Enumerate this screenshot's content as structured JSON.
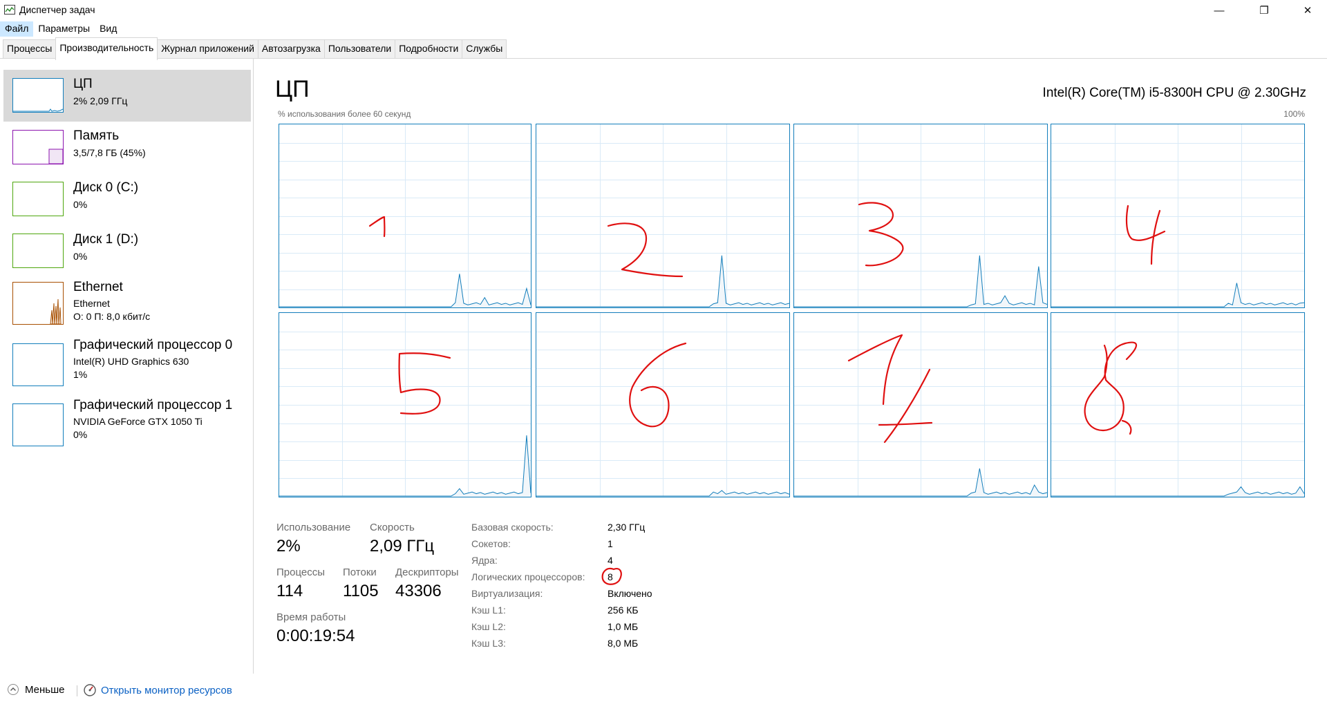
{
  "window": {
    "title": "Диспетчер задач",
    "minimize_glyph": "—",
    "maximize_glyph": "❐",
    "close_glyph": "✕"
  },
  "menu": [
    "Файл",
    "Параметры",
    "Вид"
  ],
  "tabs": [
    "Процессы",
    "Производительность",
    "Журнал приложений",
    "Автозагрузка",
    "Пользователи",
    "Подробности",
    "Службы"
  ],
  "active_tab": "Производительность",
  "sidebar": [
    {
      "name": "ЦП",
      "sub1": "2%  2,09 ГГц",
      "color": "#117dbb",
      "selected": true
    },
    {
      "name": "Память",
      "sub1": "3,5/7,8 ГБ (45%)",
      "color": "#8b12ae"
    },
    {
      "name": "Диск 0 (C:)",
      "sub1": "0%",
      "color": "#4da60c"
    },
    {
      "name": "Диск 1 (D:)",
      "sub1": "0%",
      "color": "#4da60c"
    },
    {
      "name": "Ethernet",
      "sub1": "Ethernet",
      "sub2": "О: 0  П: 8,0 кбит/с",
      "color": "#a74f01"
    },
    {
      "name": "Графический процессор 0",
      "sub1": "Intel(R) UHD Graphics 630",
      "sub2": "1%",
      "color": "#117dbb"
    },
    {
      "name": "Графический процессор 1",
      "sub1": "NVIDIA GeForce GTX 1050 Ti",
      "sub2": "0%",
      "color": "#117dbb"
    }
  ],
  "main": {
    "title": "ЦП",
    "cpu_model": "Intel(R) Core(TM) i5-8300H CPU @ 2.30GHz",
    "graph_caption": "% использования более 60 секунд",
    "graph_max": "100%",
    "graph_color": "#117dbb",
    "annotation_color": "#e01010",
    "annotations": [
      "1",
      "2",
      "3",
      "4",
      "5",
      "6",
      "7",
      "8"
    ]
  },
  "stats": {
    "usage_label": "Использование",
    "usage_value": "2%",
    "speed_label": "Скорость",
    "speed_value": "2,09 ГГц",
    "processes_label": "Процессы",
    "processes_value": "114",
    "threads_label": "Потоки",
    "threads_value": "1105",
    "handles_label": "Дескрипторы",
    "handles_value": "43306",
    "uptime_label": "Время работы",
    "uptime_value": "0:00:19:54"
  },
  "specs": [
    {
      "label": "Базовая скорость:",
      "value": "2,30 ГГц"
    },
    {
      "label": "Сокетов:",
      "value": "1"
    },
    {
      "label": "Ядра:",
      "value": "4"
    },
    {
      "label": "Логических процессоров:",
      "value": "8"
    },
    {
      "label": "Виртуализация:",
      "value": "Включено"
    },
    {
      "label": "Кэш L1:",
      "value": "256 КБ"
    },
    {
      "label": "Кэш L2:",
      "value": "1,0 МБ"
    },
    {
      "label": "Кэш L3:",
      "value": "8,0 МБ"
    }
  ],
  "footer": {
    "less_label": "Меньше",
    "resmon_label": "Открыть монитор ресурсов"
  }
}
